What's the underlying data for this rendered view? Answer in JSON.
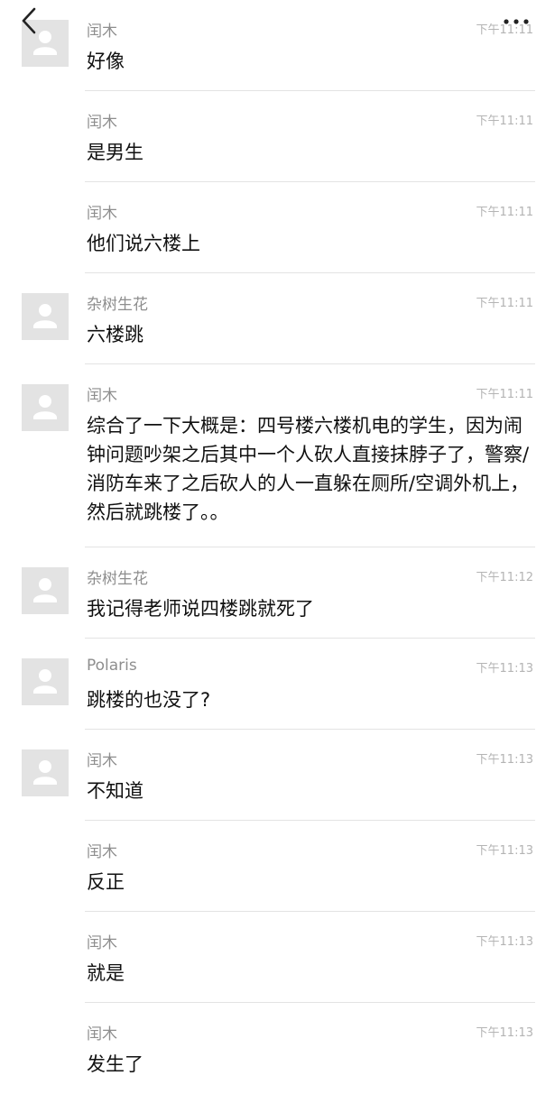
{
  "messages": [
    {
      "sender": "闰木",
      "time": "下午11:11",
      "text": "好像",
      "avatar": true
    },
    {
      "sender": "闰木",
      "time": "下午11:11",
      "text": "是男生",
      "avatar": false
    },
    {
      "sender": "闰木",
      "time": "下午11:11",
      "text": "他们说六楼上",
      "avatar": false
    },
    {
      "sender": "杂树生花",
      "time": "下午11:11",
      "text": "六楼跳",
      "avatar": true
    },
    {
      "sender": "闰木",
      "time": "下午11:11",
      "text": "综合了一下大概是：四号楼六楼机电的学生，因为闹钟问题吵架之后其中一个人砍人直接抹脖子了，警察/消防车来了之后砍人的人一直躲在厕所/空调外机上，然后就跳楼了。。",
      "avatar": true
    },
    {
      "sender": "杂树生花",
      "time": "下午11:12",
      "text": "我记得老师说四楼跳就死了",
      "avatar": true
    },
    {
      "sender": "Polaris",
      "time": "下午11:13",
      "text": "跳楼的也没了?",
      "avatar": true
    },
    {
      "sender": "闰木",
      "time": "下午11:13",
      "text": "不知道",
      "avatar": true
    },
    {
      "sender": "闰木",
      "time": "下午11:13",
      "text": "反正",
      "avatar": false
    },
    {
      "sender": "闰木",
      "time": "下午11:13",
      "text": "就是",
      "avatar": false
    },
    {
      "sender": "闰木",
      "time": "下午11:13",
      "text": "发生了",
      "avatar": false
    }
  ],
  "icons": {
    "back": "chevron-left-icon",
    "more": "more-dots-icon",
    "avatar": "default-user-icon"
  },
  "colors": {
    "sender": "#8e8e8e",
    "time": "#b4b4b4",
    "text": "#111111",
    "divider": "#e3e3e3",
    "avatar_bg": "#e3e3e3",
    "avatar_glyph": "#ffffff"
  }
}
